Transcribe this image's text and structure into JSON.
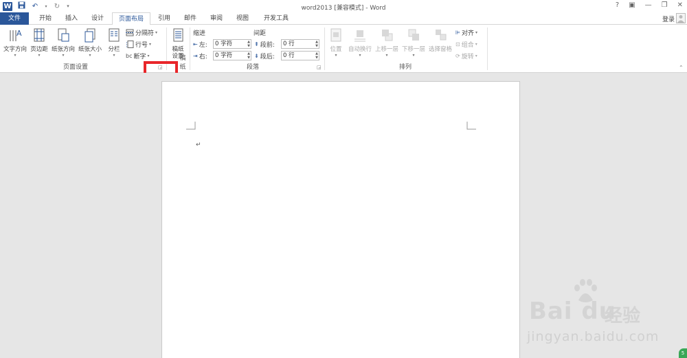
{
  "window": {
    "title": "word2013 [兼容模式] - Word",
    "controls": [
      "?",
      "▣",
      "—",
      "❐",
      "✕"
    ]
  },
  "qat": {
    "undo": "↶",
    "redo": "↻"
  },
  "tabs": [
    {
      "label": "文件"
    },
    {
      "label": "开始"
    },
    {
      "label": "插入"
    },
    {
      "label": "设计"
    },
    {
      "label": "页面布局"
    },
    {
      "label": "引用"
    },
    {
      "label": "邮件"
    },
    {
      "label": "审阅"
    },
    {
      "label": "视图"
    },
    {
      "label": "开发工具"
    }
  ],
  "active_tab": "页面布局",
  "account": {
    "login_label": "登录"
  },
  "ribbon": {
    "page_setup": {
      "label": "页面设置",
      "text_direction": "文字方向",
      "margins": "页边距",
      "orientation": "纸张方向",
      "size": "纸张大小",
      "columns": "分栏",
      "breaks": "分隔符",
      "line_numbers": "行号",
      "hyphenation": "断字",
      "hyphen_icon_text": "bc"
    },
    "manuscript": {
      "label": "稿纸",
      "button_line1": "稿纸",
      "button_line2": "设置"
    },
    "paragraph": {
      "label": "段落",
      "indent_header": "缩进",
      "spacing_header": "间距",
      "left_label": "左:",
      "left_value": "0 字符",
      "right_label": "右:",
      "right_value": "0 字符",
      "before_label": "段前:",
      "before_value": "0 行",
      "after_label": "段后:",
      "after_value": "0 行"
    },
    "arrange": {
      "label": "排列",
      "position": "位置",
      "wrap_text": "自动换行",
      "bring_forward": "上移一层",
      "send_backward": "下移一层",
      "selection_pane": "选择窗格",
      "align": "对齐",
      "group": "组合",
      "rotate": "旋转"
    }
  },
  "document": {
    "paragraph_mark": "↵"
  },
  "watermark": {
    "logo_text": "Bai du",
    "jingyan": "经验",
    "url": "jingyan.baidu.com"
  },
  "colors": {
    "accent": "#2b579a",
    "highlight": "#e8262a"
  }
}
